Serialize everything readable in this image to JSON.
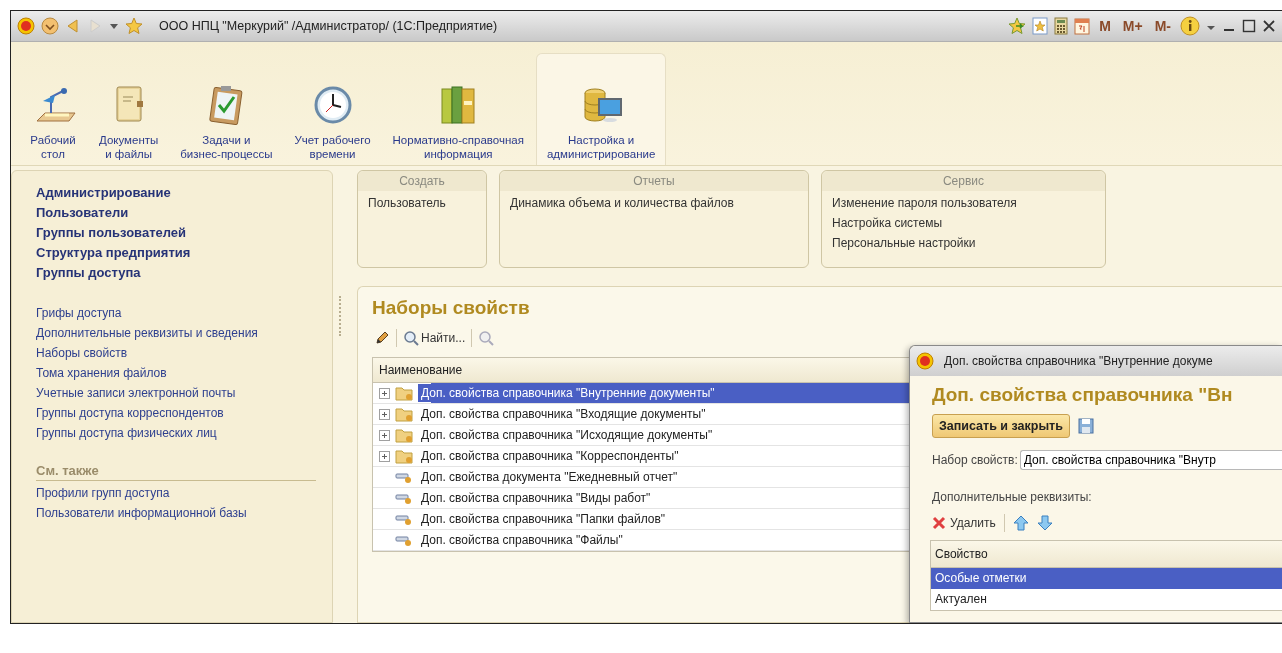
{
  "title_bar": {
    "title": "ООО НПЦ \"Меркурий\" /Администратор/  (1С:Предприятие)",
    "memory": [
      "M",
      "M+",
      "M-"
    ]
  },
  "sections": [
    {
      "label": "Рабочий\nстол",
      "selected": false
    },
    {
      "label": "Документы\nи файлы",
      "selected": false
    },
    {
      "label": "Задачи и\nбизнес-процессы",
      "selected": false
    },
    {
      "label": "Учет рабочего\nвремени",
      "selected": false
    },
    {
      "label": "Нормативно-справочная\nинформация",
      "selected": false
    },
    {
      "label": "Настройка и\nадминистрирование",
      "selected": true
    }
  ],
  "navigation": {
    "main": [
      "Администрирование",
      "Пользователи",
      "Группы пользователей",
      "Структура предприятия",
      "Группы доступа"
    ],
    "more": [
      "Грифы доступа",
      "Дополнительные реквизиты и сведения",
      "Наборы свойств",
      "Тома хранения файлов",
      "Учетные записи электронной почты",
      "Группы доступа корреспондентов",
      "Группы доступа физических лиц"
    ],
    "see_also": {
      "title": "См. также",
      "items": [
        "Профили групп доступа",
        "Пользователи информационной базы"
      ]
    }
  },
  "command_groups": [
    {
      "title": "Создать",
      "items": [
        "Пользователь"
      ]
    },
    {
      "title": "Отчеты",
      "items": [
        "Динамика объема и количества файлов"
      ]
    },
    {
      "title": "Сервис",
      "items": [
        "Изменение пароля пользователя",
        "Настройка системы",
        "Персональные настройки"
      ]
    }
  ],
  "list": {
    "title": "Наборы свойств",
    "find_button": "Найти...",
    "column": "Наименование",
    "rows": [
      {
        "kind": "group",
        "expanded": false,
        "selected": true,
        "text": "Доп. свойства справочника \"Внутренние документы\""
      },
      {
        "kind": "group",
        "expanded": false,
        "selected": false,
        "text": "Доп. свойства справочника \"Входящие документы\""
      },
      {
        "kind": "group",
        "expanded": false,
        "selected": false,
        "text": "Доп. свойства справочника \"Исходящие документы\""
      },
      {
        "kind": "group",
        "expanded": false,
        "selected": false,
        "text": "Доп. свойства справочника \"Корреспонденты\""
      },
      {
        "kind": "item",
        "selected": false,
        "text": "Доп. свойства документа \"Ежедневный отчет\""
      },
      {
        "kind": "item",
        "selected": false,
        "text": "Доп. свойства справочника \"Виды работ\""
      },
      {
        "kind": "item",
        "selected": false,
        "text": "Доп. свойства справочника \"Папки файлов\""
      },
      {
        "kind": "item",
        "selected": false,
        "text": "Доп. свойства справочника \"Файлы\""
      }
    ]
  },
  "dialog": {
    "title": "Доп. свойства справочника \"Внутренние докуме",
    "heading": "Доп. свойства справочника \"Вн",
    "save_button": "Записать и закрыть",
    "field": {
      "label": "Набор свойств:",
      "value": "Доп. свойства справочника \"Внутр"
    },
    "section_label": "Дополнительные реквизиты:",
    "delete_button": "Удалить",
    "table": {
      "column": "Свойство",
      "rows": [
        {
          "text": "Особые отметки",
          "selected": true
        },
        {
          "text": "Актуален",
          "selected": false
        }
      ]
    }
  }
}
